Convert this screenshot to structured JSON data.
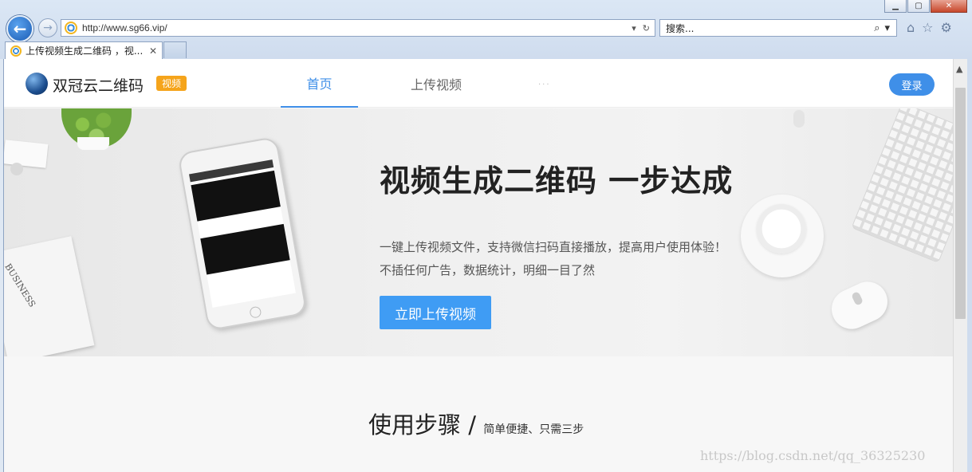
{
  "browser": {
    "address_url": "http://www.sg66.vip/",
    "search_placeholder": "搜索...",
    "tab_title": "上传视频生成二维码 ，视...",
    "icons": [
      "back-arrow-icon",
      "forward-arrow-icon",
      "ie-logo-icon",
      "dropdown-icon",
      "refresh-icon",
      "search-icon",
      "home-icon",
      "favorites-star-icon",
      "gear-icon",
      "minimize-icon",
      "maximize-icon",
      "close-icon"
    ]
  },
  "site": {
    "brand": "双冠云二维码",
    "badge": "视频",
    "nav": {
      "home": "首页",
      "upload": "上传视频",
      "more": "..."
    },
    "login": "登录"
  },
  "hero": {
    "title": "视频生成二维码 一步达成",
    "line1": "一键上传视频文件，支持微信扫码直接播放，提高用户使用体验！",
    "line2": "不插任何广告，数据统计，明细一目了然",
    "cta": "立即上传视频"
  },
  "steps": {
    "title": "使用步骤",
    "separator": " / ",
    "subtitle": "简单便捷、只需三步"
  },
  "watermark": "https://blog.csdn.net/qq_36325230",
  "colors": {
    "accent": "#3f8fe8",
    "badge": "#f5a41b",
    "cta": "#3f9cf4"
  }
}
